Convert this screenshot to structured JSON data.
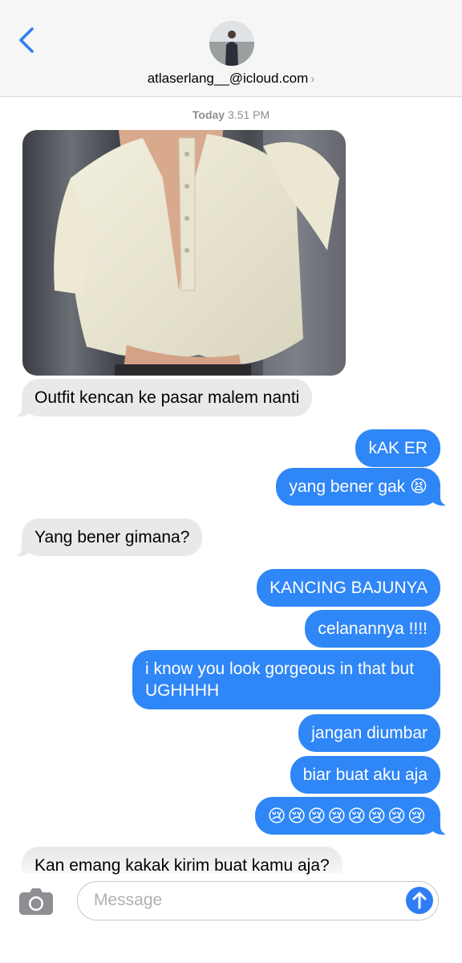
{
  "header": {
    "contact_name": "atlaserlang__@icloud.com",
    "chevron": "›",
    "back_icon": "chevron-left-icon",
    "accent": "#2f7df6"
  },
  "timestamp": {
    "day": "Today",
    "time": "3.51 PM"
  },
  "messages": [
    {
      "from": "them",
      "text": "Outfit kencan ke pasar malem nanti"
    },
    {
      "from": "me",
      "text": "kAK ER"
    },
    {
      "from": "me",
      "text": "yang bener gak 😫"
    },
    {
      "from": "them",
      "text": "Yang bener gimana?"
    },
    {
      "from": "me",
      "text": "KANCING BAJUNYA"
    },
    {
      "from": "me",
      "text": "celanannya !!!!"
    },
    {
      "from": "me",
      "text": "i know you look gorgeous in that but UGHHHH"
    },
    {
      "from": "me",
      "text": "jangan diumbar"
    },
    {
      "from": "me",
      "text": "biar buat aku aja"
    },
    {
      "from": "me",
      "text": "😢😢😢😢😢😢😢😢"
    },
    {
      "from": "them",
      "text": "Kan emang kakak kirim buat kamu aja?"
    }
  ],
  "input": {
    "placeholder": "Message"
  },
  "colors": {
    "outgoing": "#2f86f6",
    "incoming": "#e9e9eb"
  }
}
